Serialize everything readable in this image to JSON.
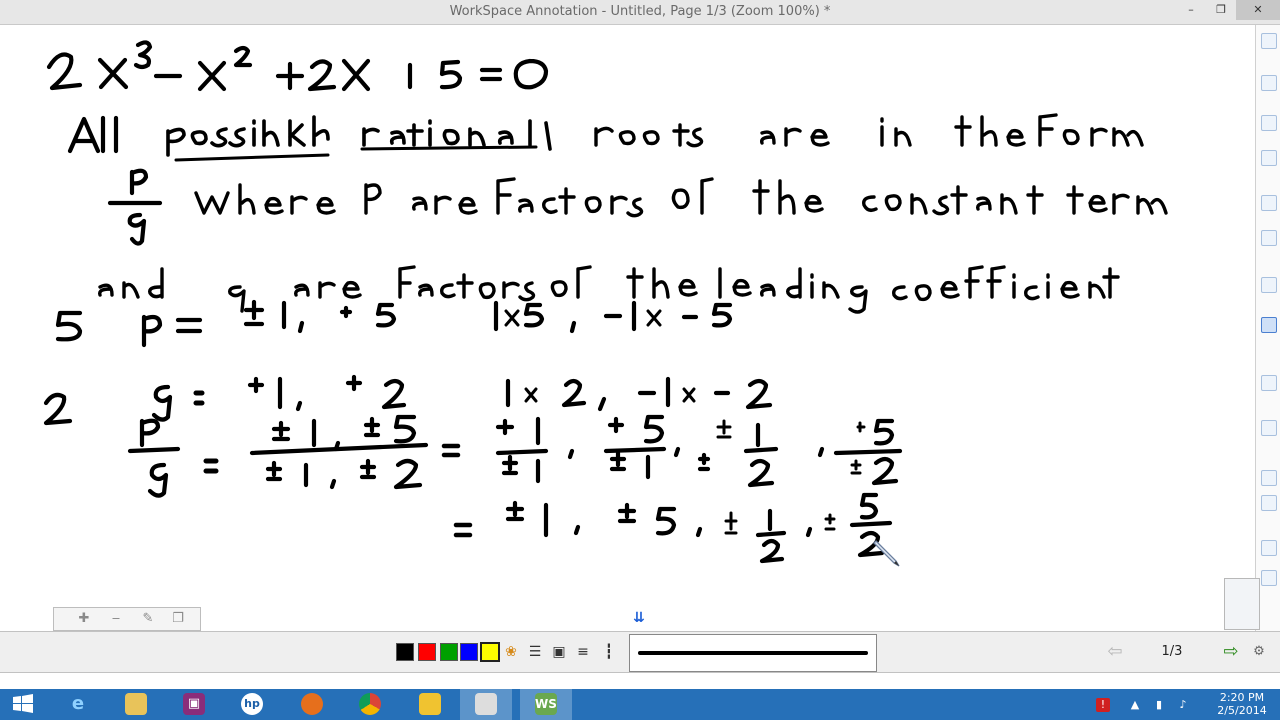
{
  "window": {
    "title": "WorkSpace Annotation - Untitled, Page 1/3  (Zoom 100%) *",
    "minimize_icon": "minimize-icon",
    "maximize_icon": "restore-icon",
    "close_icon": "close-icon"
  },
  "canvas": {
    "ink_color": "#000000",
    "handwritten_lines": [
      "2x³ − x² + 2x + 5 = 0",
      "All possible rational roots are in the form",
      "p/q where p are factors of the constant term",
      "and q are factors of the leading coefficient",
      "5   p = ±1, ±5     1·5, −1·−5",
      "2   q = ±1, ±2     1·2, −1·−2",
      "p/q = ±1, ±5 / ±1, ±2 = ±1/±1, ±5/±1, ±1/2, ±5/±2",
      "= ±1, ±5, ±1/2, ±5/2"
    ]
  },
  "zoom_toolbar": {
    "buttons": [
      "zoom-in-icon",
      "zoom-out-icon",
      "edit-page-icon",
      "copy-page-icon"
    ]
  },
  "toolbar": {
    "colors": [
      "#000000",
      "#ff0000",
      "#00a000",
      "#0000ff",
      "#ffff00"
    ],
    "selected_color": "#ffff00",
    "page_indicator": "1/3"
  },
  "taskbar": {
    "apps": [
      "start",
      "internet-explorer",
      "file-explorer",
      "presentation",
      "hp",
      "firefox",
      "chrome",
      "app",
      "video",
      "workspace"
    ],
    "active_app": "workspace",
    "time": "2:20 PM",
    "date": "2/5/2014"
  }
}
